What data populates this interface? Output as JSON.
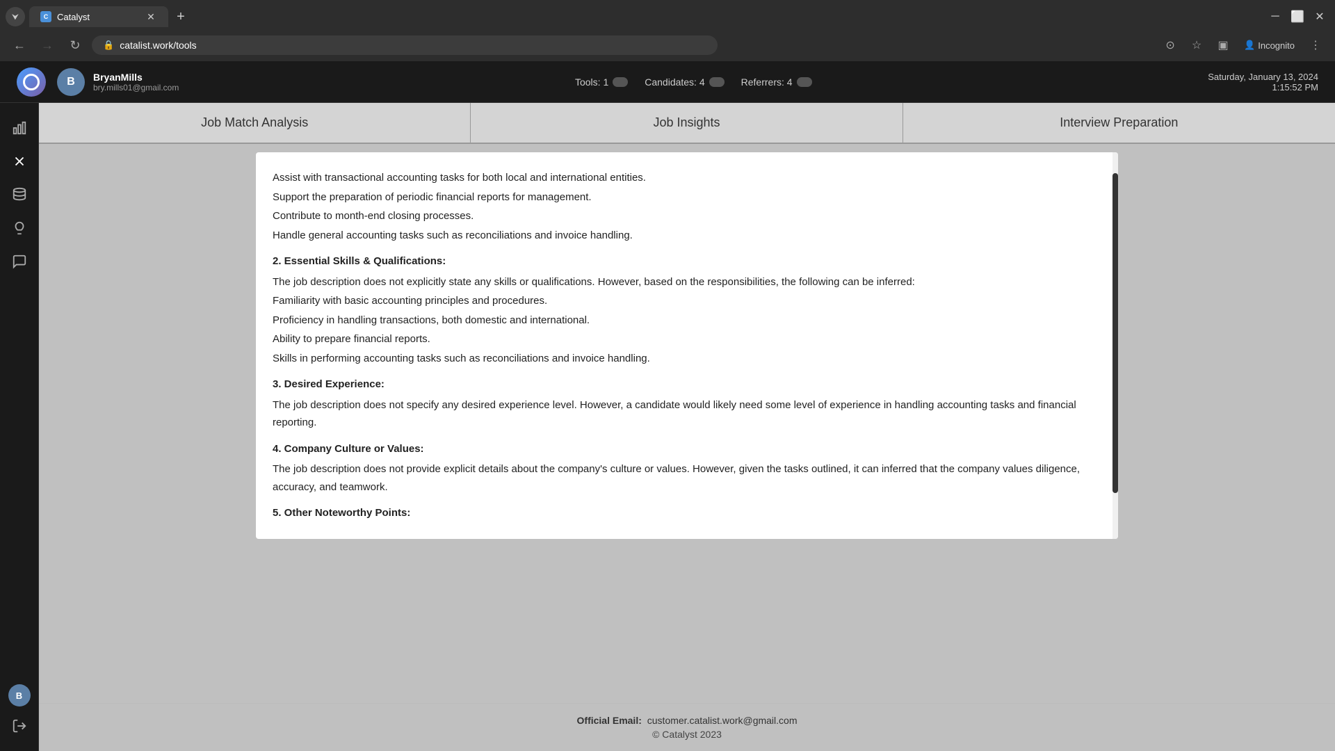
{
  "browser": {
    "tab_title": "Catalyst",
    "url": "catalist.work/tools",
    "new_tab_label": "+",
    "incognito_label": "Incognito"
  },
  "topbar": {
    "user_name": "BryanMills",
    "user_email": "bry.mills01@gmail.com",
    "user_initial": "B",
    "tools_label": "Tools: 1",
    "candidates_label": "Candidates: 4",
    "referrers_label": "Referrers: 4",
    "date": "Saturday, January 13, 2024",
    "time": "1:15:52 PM"
  },
  "tabs": [
    {
      "label": "Job Match Analysis"
    },
    {
      "label": "Job Insights"
    },
    {
      "label": "Interview Preparation"
    }
  ],
  "content": {
    "lines": [
      "Assist with transactional accounting tasks for both local and international entities.",
      "Support the preparation of periodic financial reports for management.",
      "Contribute to month-end closing processes.",
      "Handle general accounting tasks such as reconciliations and invoice handling."
    ],
    "section2_heading": "2. Essential Skills & Qualifications:",
    "section2_intro": "The job description does not explicitly state any skills or qualifications. However, based on the responsibilities, the following can be inferred:",
    "section2_lines": [
      "Familiarity with basic accounting principles and procedures.",
      "Proficiency in handling transactions, both domestic and international.",
      "Ability to prepare financial reports.",
      "Skills in performing accounting tasks such as reconciliations and invoice handling."
    ],
    "section3_heading": "3. Desired Experience:",
    "section3_text": "The job description does not specify any desired experience level. However, a candidate would likely need some level of experience in handling accounting tasks and financial reporting.",
    "section4_heading": "4. Company Culture or Values:",
    "section4_text": "The job description does not provide explicit details about the company's culture or values. However, given the tasks outlined, it can inferred that the company values diligence, accuracy, and teamwork.",
    "section5_heading": "5. Other Noteworthy Points:"
  },
  "footer": {
    "email_label": "Official Email:",
    "email": "customer.catalist.work@gmail.com",
    "copyright": "© Catalyst 2023"
  },
  "sidebar": {
    "icons": [
      {
        "name": "chart-icon",
        "symbol": "📊"
      },
      {
        "name": "tools-icon",
        "symbol": "✕"
      },
      {
        "name": "database-icon",
        "symbol": "🗄"
      },
      {
        "name": "bulb-icon",
        "symbol": "💡"
      },
      {
        "name": "chat-icon",
        "symbol": "💬"
      }
    ],
    "bottom_initial": "B",
    "logout_icon": "→"
  }
}
